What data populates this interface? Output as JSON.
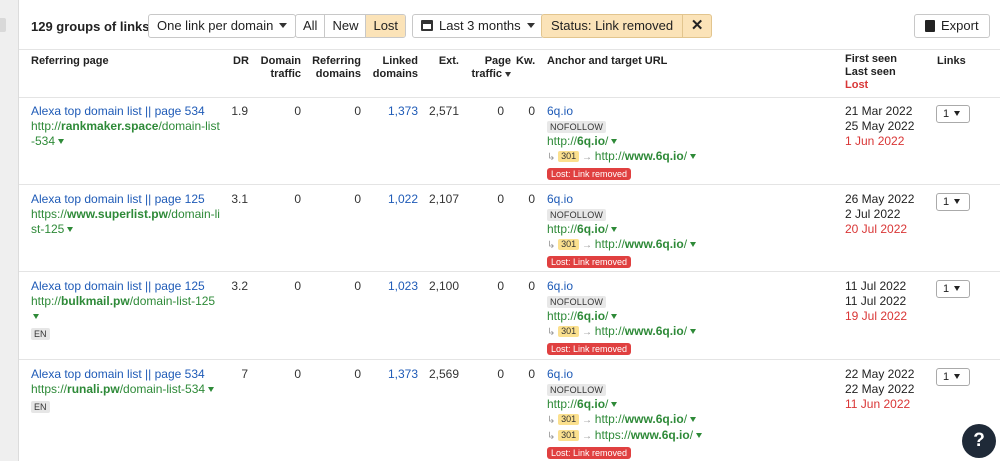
{
  "toolbar": {
    "groups_count": "129 groups of links",
    "grouping": "One link per domain",
    "filter_tabs": [
      "All",
      "New",
      "Lost"
    ],
    "active_tab": "Lost",
    "period": "Last 3 months",
    "status_filter": "Status: Link removed",
    "status_clear": "✕",
    "export": "Export"
  },
  "columns": {
    "referring_page": "Referring page",
    "dr": "DR",
    "domain_traffic": [
      "Domain",
      "traffic"
    ],
    "referring_domains": [
      "Referring",
      "domains"
    ],
    "linked_domains": [
      "Linked",
      "domains"
    ],
    "ext": "Ext.",
    "page_traffic": [
      "Page",
      "traffic"
    ],
    "kw": "Kw.",
    "anchor": "Anchor and target URL",
    "first_seen": "First seen",
    "last_seen": "Last seen",
    "lost": "Lost",
    "links": "Links"
  },
  "rows": [
    {
      "title": "Alexa top domain list || page 534",
      "url_pre": "http://",
      "url_domain": "rankmaker.space",
      "url_path1": "/domain-list",
      "url_path2": "-534",
      "lang": "",
      "dr": "1.9",
      "domain_traffic": "0",
      "referring_domains": "0",
      "linked_domains": "1,373",
      "ext": "2,571",
      "page_traffic": "0",
      "kw": "0",
      "anchor": "6q.io",
      "nofollow": "NOFOLLOW",
      "target_pre": "http://",
      "target_domain": "6q.io",
      "target_path": "/",
      "redirects": [
        {
          "code": "301",
          "pre": "http://",
          "domain": "www.6q.io",
          "path": "/"
        }
      ],
      "lost_badge": "Lost: Link removed",
      "first_seen": "21 Mar 2022",
      "last_seen": "25 May 2022",
      "lost": "1 Jun 2022",
      "links": "1"
    },
    {
      "title": "Alexa top domain list || page 125",
      "url_pre": "https://",
      "url_domain": "www.superlist.pw",
      "url_path1": "/domain-li",
      "url_path2": "st-125",
      "lang": "",
      "dr": "3.1",
      "domain_traffic": "0",
      "referring_domains": "0",
      "linked_domains": "1,022",
      "ext": "2,107",
      "page_traffic": "0",
      "kw": "0",
      "anchor": "6q.io",
      "nofollow": "NOFOLLOW",
      "target_pre": "http://",
      "target_domain": "6q.io",
      "target_path": "/",
      "redirects": [
        {
          "code": "301",
          "pre": "http://",
          "domain": "www.6q.io",
          "path": "/"
        }
      ],
      "lost_badge": "Lost: Link removed",
      "first_seen": "26 May 2022",
      "last_seen": "2 Jul 2022",
      "lost": "20 Jul 2022",
      "links": "1"
    },
    {
      "title": "Alexa top domain list || page 125",
      "url_pre": "http://",
      "url_domain": "bulkmail.pw",
      "url_path1": "/domain-list-125",
      "url_path2": "",
      "lang": "EN",
      "dr": "3.2",
      "domain_traffic": "0",
      "referring_domains": "0",
      "linked_domains": "1,023",
      "ext": "2,100",
      "page_traffic": "0",
      "kw": "0",
      "anchor": "6q.io",
      "nofollow": "NOFOLLOW",
      "target_pre": "http://",
      "target_domain": "6q.io",
      "target_path": "/",
      "redirects": [
        {
          "code": "301",
          "pre": "http://",
          "domain": "www.6q.io",
          "path": "/"
        }
      ],
      "lost_badge": "Lost: Link removed",
      "first_seen": "11 Jul 2022",
      "last_seen": "11 Jul 2022",
      "lost": "19 Jul 2022",
      "links": "1"
    },
    {
      "title": "Alexa top domain list || page 534",
      "url_pre": "https://",
      "url_domain": "runali.pw",
      "url_path1": "/domain-list-534",
      "url_path2": "",
      "lang": "EN",
      "dr": "7",
      "domain_traffic": "0",
      "referring_domains": "0",
      "linked_domains": "1,373",
      "ext": "2,569",
      "page_traffic": "0",
      "kw": "0",
      "anchor": "6q.io",
      "nofollow": "NOFOLLOW",
      "target_pre": "http://",
      "target_domain": "6q.io",
      "target_path": "/",
      "redirects": [
        {
          "code": "301",
          "pre": "http://",
          "domain": "www.6q.io",
          "path": "/"
        },
        {
          "code": "301",
          "pre": "https://",
          "domain": "www.6q.io",
          "path": "/"
        }
      ],
      "lost_badge": "Lost: Link removed",
      "first_seen": "22 May 2022",
      "last_seen": "22 May 2022",
      "lost": "11 Jun 2022",
      "links": "1"
    }
  ],
  "help": "?"
}
